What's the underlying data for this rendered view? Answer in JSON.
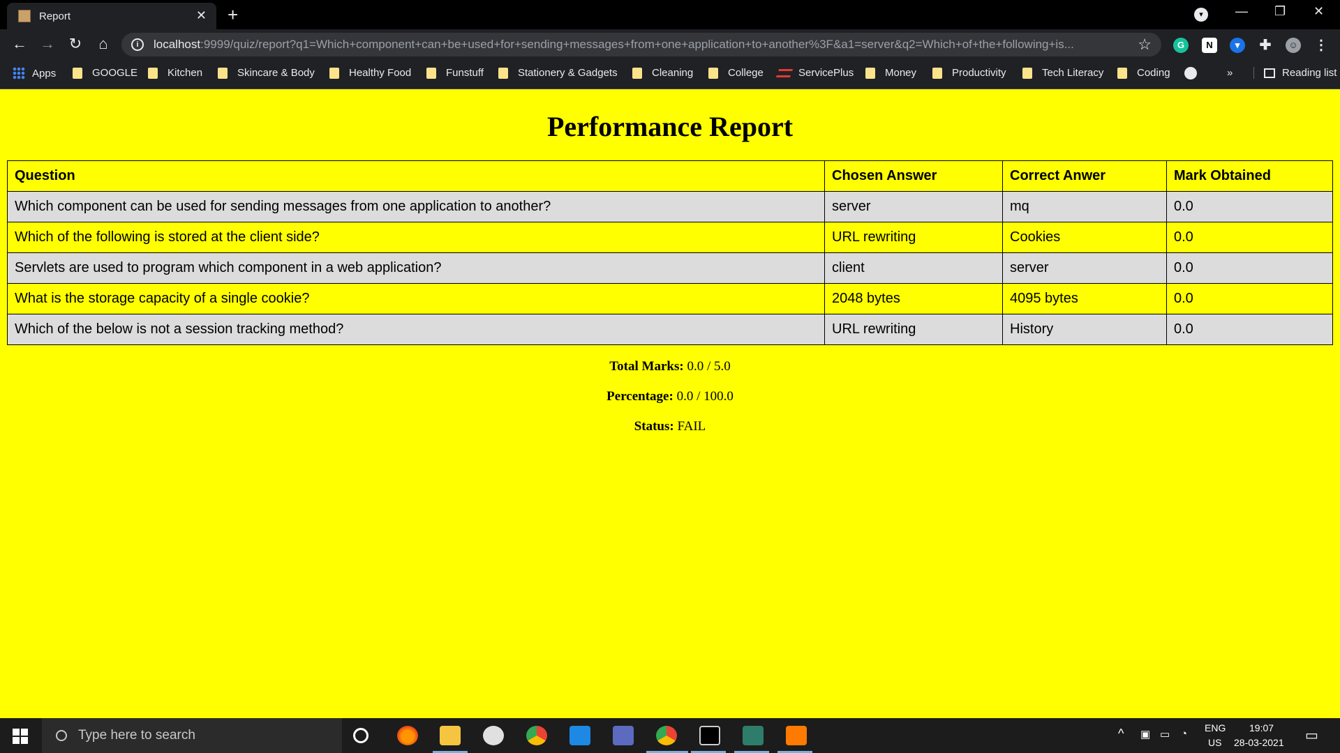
{
  "browser": {
    "tab_title": "Report",
    "url_host": "localhost",
    "url_rest": ":9999/quiz/report?q1=Which+component+can+be+used+for+sending+messages+from+one+application+to+another%3F&a1=server&q2=Which+of+the+following+is...",
    "bookmarks": [
      "Apps",
      "GOOGLE",
      "Kitchen",
      "Skincare & Body",
      "Healthy Food",
      "Funstuff",
      "Stationery & Gadgets",
      "Cleaning",
      "College",
      "ServicePlus",
      "Money",
      "Productivity",
      "Tech Literacy",
      "Coding"
    ],
    "more_bookmarks": "»",
    "reading_list": "Reading list",
    "tab_close": "✕",
    "new_tab": "+"
  },
  "report": {
    "title": "Performance Report",
    "headers": [
      "Question",
      "Chosen Answer",
      "Correct Anwer",
      "Mark Obtained"
    ],
    "rows": [
      {
        "question": "Which component can be used for sending messages from one application to another?",
        "chosen": "server",
        "correct": "mq",
        "mark": "0.0"
      },
      {
        "question": "Which of the following is stored at the client side?",
        "chosen": "URL rewriting",
        "correct": "Cookies",
        "mark": "0.0"
      },
      {
        "question": "Servlets are used to program which component in a web application?",
        "chosen": "client",
        "correct": "server",
        "mark": "0.0"
      },
      {
        "question": "What is the storage capacity of a single cookie?",
        "chosen": "2048 bytes",
        "correct": "4095 bytes",
        "mark": "0.0"
      },
      {
        "question": "Which of the below is not a session tracking method?",
        "chosen": "URL rewriting",
        "correct": "History",
        "mark": "0.0"
      }
    ],
    "total_label": "Total Marks:",
    "total_value": "0.0 / 5.0",
    "percentage_label": "Percentage:",
    "percentage_value": "0.0 / 100.0",
    "status_label": "Status:",
    "status_value": "FAIL"
  },
  "taskbar": {
    "search_placeholder": "Type here to search",
    "language": "ENG",
    "region": "US",
    "time": "19:07",
    "date": "28-03-2021"
  },
  "colors": {
    "page_background": "#ffff00",
    "even_row": "#dcdcdc",
    "chrome_dark": "#202124"
  }
}
